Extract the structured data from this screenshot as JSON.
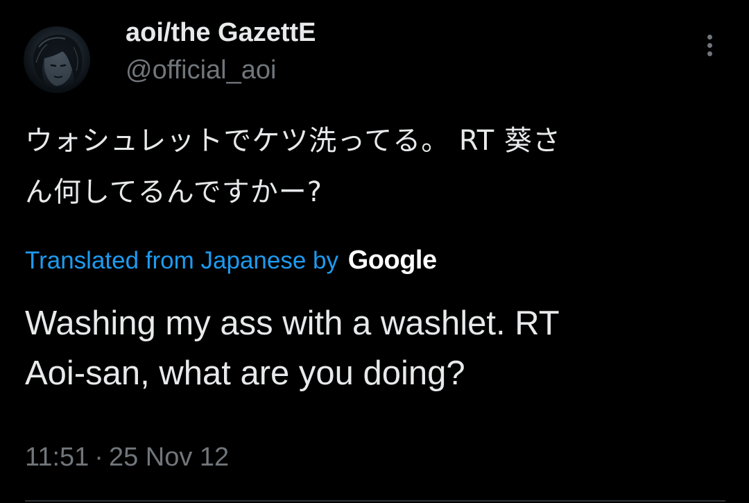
{
  "author": {
    "display_name": "aoi/the GazettE",
    "handle": "@official_aoi"
  },
  "tweet": {
    "text_line_1": "ウォシュレットでケツ洗ってる。 RT 葵さ",
    "text_line_2": "ん何してるんですかー?",
    "translation_credit": "Translated from Japanese by",
    "translation_provider": "Google",
    "translated_line_1": "Washing my ass with a washlet. RT",
    "translated_line_2": "Aoi-san, what are you doing?",
    "time": "11:51",
    "separator": "·",
    "date": "25 Nov 12"
  },
  "icons": {
    "more": "more-vertical-icon",
    "avatar": "user-avatar"
  },
  "colors": {
    "background": "#000000",
    "primary_text": "#e7e9ea",
    "secondary_text": "#71767b",
    "link": "#1d9bf0",
    "divider": "#2f3336"
  }
}
